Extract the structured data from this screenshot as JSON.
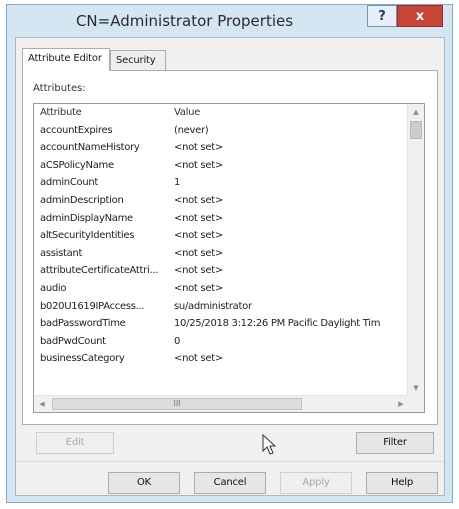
{
  "window": {
    "title": "CN=Administrator Properties",
    "help_glyph": "?",
    "close_glyph": "x"
  },
  "tabs": [
    {
      "label": "Attribute Editor",
      "active": true
    },
    {
      "label": "Security",
      "active": false
    }
  ],
  "attributes": {
    "label": "Attributes:",
    "columns": [
      "Attribute",
      "Value"
    ],
    "rows": [
      [
        "accountExpires",
        "(never)"
      ],
      [
        "accountNameHistory",
        "<not set>"
      ],
      [
        "aCSPolicyName",
        "<not set>"
      ],
      [
        "adminCount",
        "1"
      ],
      [
        "adminDescription",
        "<not set>"
      ],
      [
        "adminDisplayName",
        "<not set>"
      ],
      [
        "altSecurityIdentities",
        "<not set>"
      ],
      [
        "assistant",
        "<not set>"
      ],
      [
        "attributeCertificateAttri...",
        "<not set>"
      ],
      [
        "audio",
        "<not set>"
      ],
      [
        "b020U1619IPAccess...",
        "su/administrator"
      ],
      [
        "badPasswordTime",
        "10/25/2018 3:12:26 PM Pacific Daylight Tim"
      ],
      [
        "badPwdCount",
        "0"
      ],
      [
        "businessCategory",
        "<not set>"
      ]
    ],
    "hscroll_thumb_glyph": "III"
  },
  "buttons": {
    "edit": "Edit",
    "filter": "Filter",
    "ok": "OK",
    "cancel": "Cancel",
    "apply": "Apply",
    "help": "Help"
  },
  "colors": {
    "frame": "#d5e6f3",
    "close": "#c74537",
    "disabled_text": "#a8a8a8"
  }
}
